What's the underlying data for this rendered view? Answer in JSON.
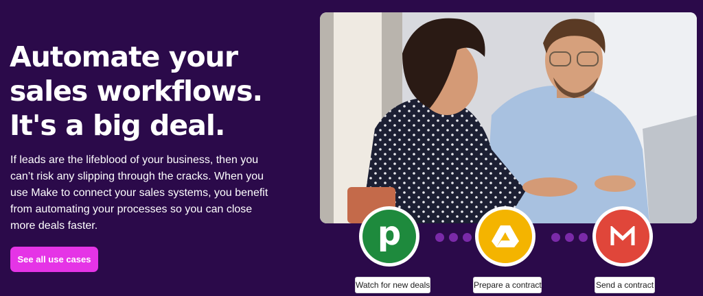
{
  "hero": {
    "headline": "Automate your sales workflows. It's a big deal.",
    "body": "If leads are the lifeblood of your business, then you can’t risk any slipping through the cracks. When you use Make to connect your sales systems, you benefit from automating your processes so you can close more deals faster.",
    "cta_label": "See all use cases"
  },
  "workflow": {
    "steps": [
      {
        "app": "Pipedrive",
        "icon": "pipedrive-p-icon",
        "glyph": "p",
        "label": "Watch for new deals",
        "color": "#1e8a3d"
      },
      {
        "app": "Google Drive",
        "icon": "google-drive-icon",
        "label": "Prepare a contract",
        "color": "#f4b400"
      },
      {
        "app": "Gmail",
        "icon": "gmail-m-icon",
        "label": "Send a contract",
        "color": "#e0463a"
      }
    ],
    "connector_color": "#7a2aa8"
  },
  "colors": {
    "background": "#2b0a4a",
    "accent": "#e534e6"
  }
}
